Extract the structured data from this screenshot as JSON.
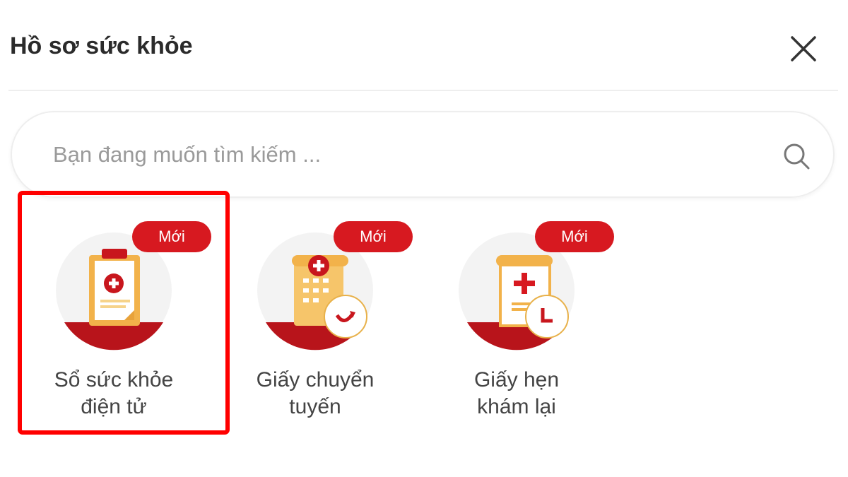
{
  "header": {
    "title": "Hồ sơ sức khỏe",
    "close_icon": "close-icon"
  },
  "search": {
    "placeholder": "Bạn đang muốn tìm kiếm ...",
    "value": "",
    "icon": "search-icon"
  },
  "items": [
    {
      "label_line1": "Sổ sức khỏe",
      "label_line2": "điện tử",
      "badge": "Mới",
      "icon": "health-record-clipboard-icon",
      "selected": true
    },
    {
      "label_line1": "Giấy chuyển",
      "label_line2": "tuyến",
      "badge": "Mới",
      "icon": "hospital-transfer-icon",
      "selected": false
    },
    {
      "label_line1": "Giấy hẹn",
      "label_line2": "khám lại",
      "badge": "Mới",
      "icon": "appointment-document-icon",
      "selected": false
    }
  ],
  "colors": {
    "accent": "#d71920",
    "highlight": "#ff0000",
    "gold": "#f2b24a"
  }
}
